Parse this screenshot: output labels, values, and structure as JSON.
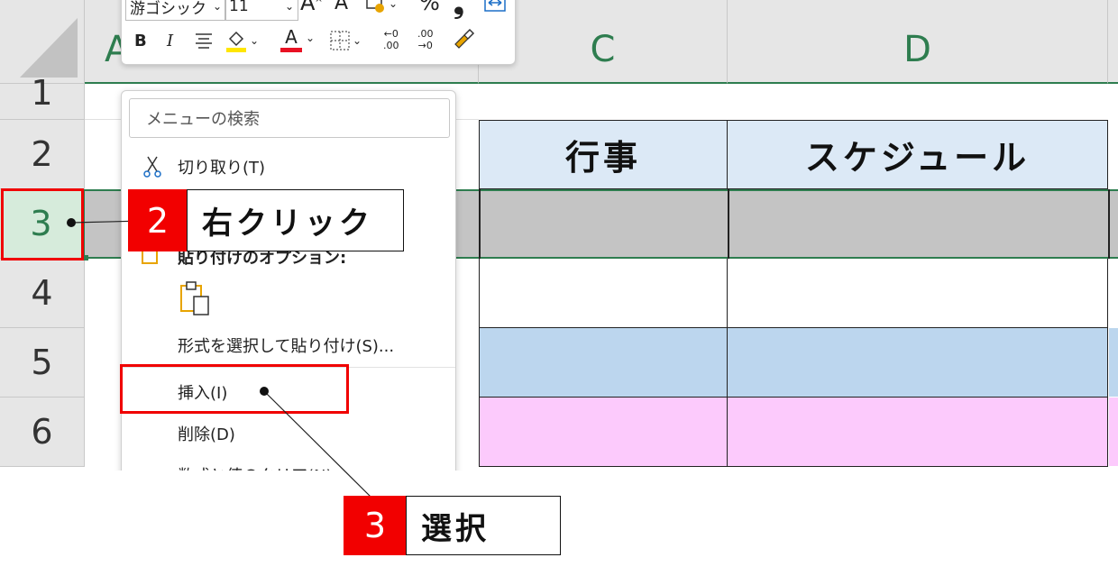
{
  "columns": [
    "A",
    "C",
    "D"
  ],
  "rows": [
    "1",
    "2",
    "3",
    "4",
    "5",
    "6"
  ],
  "table": {
    "col_c_header": "行事",
    "col_d_header": "スケジュール"
  },
  "mini_toolbar": {
    "font_name": "游ゴシック",
    "font_size": "11",
    "grow_font": "A",
    "shrink_font": "A",
    "percent": "%",
    "comma": "❟",
    "bold": "B",
    "italic": "I",
    "font_color_letter": "A",
    "inc_decimal_top": "←0",
    "inc_decimal_bottom": ".00",
    "dec_decimal_top": ".00",
    "dec_decimal_bottom": "→0"
  },
  "context_menu": {
    "search_placeholder": "メニューの検索",
    "cut": "切り取り(T)",
    "paste_options": "貼り付けのオプション:",
    "paste_special": "形式を選択して貼り付け(S)...",
    "insert": "挿入(I)",
    "delete": "削除(D)",
    "clear_contents": "数式と値のクリア(N)"
  },
  "callouts": {
    "step2_number": "2",
    "step2_text": "右クリック",
    "step3_number": "3",
    "step3_text": "選択"
  },
  "colors": {
    "accent_green": "#2e7d4f",
    "header_blue": "#dce9f6",
    "row_grey": "#c4c4c4",
    "row_blue": "#bcd6ee",
    "row_pink": "#fccafc",
    "callout_red": "#f20000"
  }
}
